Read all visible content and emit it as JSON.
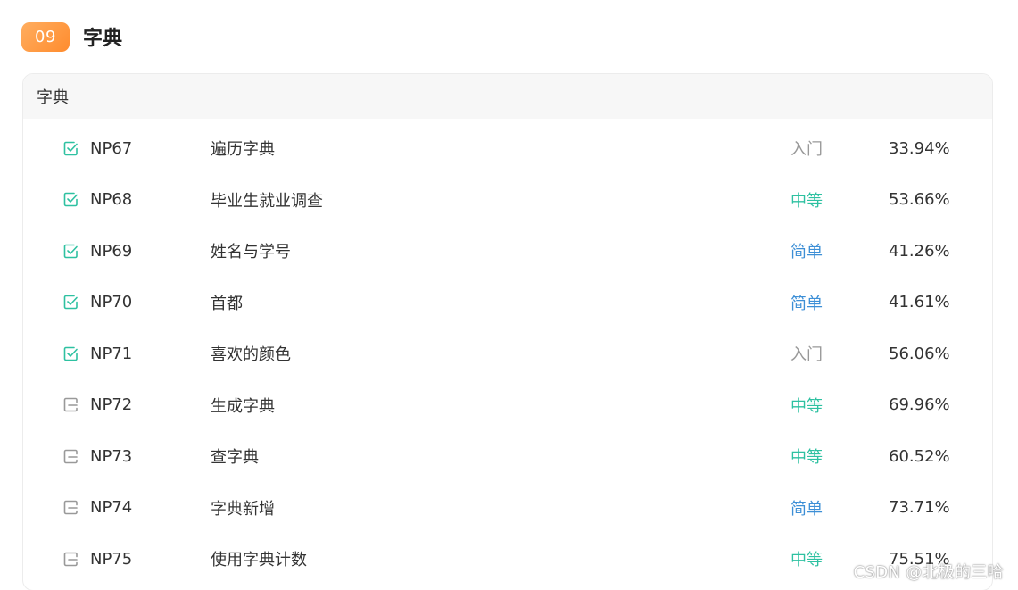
{
  "section": {
    "number": "09",
    "title": "字典"
  },
  "card": {
    "header": "字典"
  },
  "colors": {
    "badge": "#ff8c2e",
    "done_icon": "#2ec1a1",
    "todo_icon": "#999999",
    "level_entry": "#999999",
    "level_medium": "#2ec1a1",
    "level_easy": "#3d8fd6"
  },
  "problems": [
    {
      "id": "NP67",
      "title": "遍历字典",
      "level": "入门",
      "level_key": "entry",
      "rate": "33.94%",
      "status": "done",
      "icon": "checked-box-icon"
    },
    {
      "id": "NP68",
      "title": "毕业生就业调查",
      "level": "中等",
      "level_key": "medium",
      "rate": "53.66%",
      "status": "done",
      "icon": "checked-box-icon"
    },
    {
      "id": "NP69",
      "title": "姓名与学号",
      "level": "简单",
      "level_key": "easy",
      "rate": "41.26%",
      "status": "done",
      "icon": "checked-box-icon"
    },
    {
      "id": "NP70",
      "title": "首都",
      "level": "简单",
      "level_key": "easy",
      "rate": "41.61%",
      "status": "done",
      "icon": "checked-box-icon"
    },
    {
      "id": "NP71",
      "title": "喜欢的颜色",
      "level": "入门",
      "level_key": "entry",
      "rate": "56.06%",
      "status": "done",
      "icon": "checked-box-icon"
    },
    {
      "id": "NP72",
      "title": "生成字典",
      "level": "中等",
      "level_key": "medium",
      "rate": "69.96%",
      "status": "todo",
      "icon": "open-box-icon"
    },
    {
      "id": "NP73",
      "title": "查字典",
      "level": "中等",
      "level_key": "medium",
      "rate": "60.52%",
      "status": "todo",
      "icon": "open-box-icon"
    },
    {
      "id": "NP74",
      "title": "字典新增",
      "level": "简单",
      "level_key": "easy",
      "rate": "73.71%",
      "status": "todo",
      "icon": "open-box-icon"
    },
    {
      "id": "NP75",
      "title": "使用字典计数",
      "level": "中等",
      "level_key": "medium",
      "rate": "75.51%",
      "status": "todo",
      "icon": "open-box-icon"
    }
  ],
  "watermark": "CSDN @北极的三哈"
}
